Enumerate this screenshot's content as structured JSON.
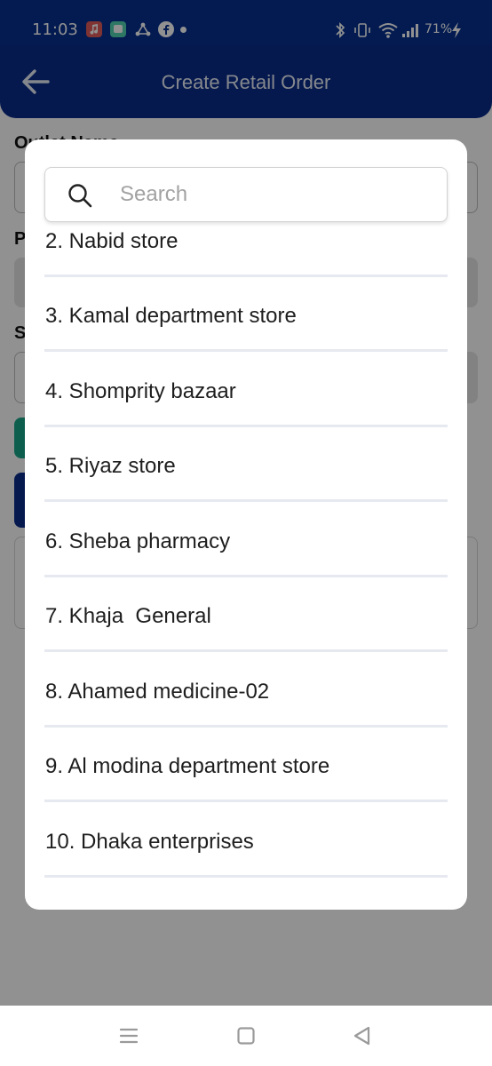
{
  "status_bar": {
    "time": "11:03",
    "battery": "71%",
    "app_icons": [
      {
        "name": "music-app-icon",
        "color": "#e05a5a"
      },
      {
        "name": "messenger-app-icon",
        "color": "#4fd1b0"
      },
      {
        "name": "recycle-app-icon",
        "color": "#ffffff"
      },
      {
        "name": "facebook-app-icon",
        "color": "#ffffff"
      }
    ]
  },
  "app_bar": {
    "title": "Create Retail Order",
    "back_icon": "arrow-left-icon"
  },
  "background_form": {
    "outlet_label": "Outlet Name",
    "label_p": "P",
    "label_s": "S"
  },
  "dialog": {
    "search": {
      "placeholder": "Search",
      "value": "",
      "icon": "search-icon"
    },
    "items": [
      "2. Nabid store",
      "3. Kamal department store",
      "4. Shomprity bazaar",
      "5. Riyaz store",
      "6. Sheba pharmacy",
      "7. Khaja  General",
      "8. Ahamed medicine-02",
      "9. Al modina department store",
      "10. Dhaka enterprises"
    ]
  },
  "nav_bar": {
    "icons": [
      "recents-menu-icon",
      "home-square-icon",
      "back-triangle-icon"
    ]
  },
  "colors": {
    "primary": "#0a2d8c",
    "status_bar": "#06308f",
    "teal_button": "#1aa58a",
    "scrim": "rgba(0,0,0,0.43)"
  }
}
